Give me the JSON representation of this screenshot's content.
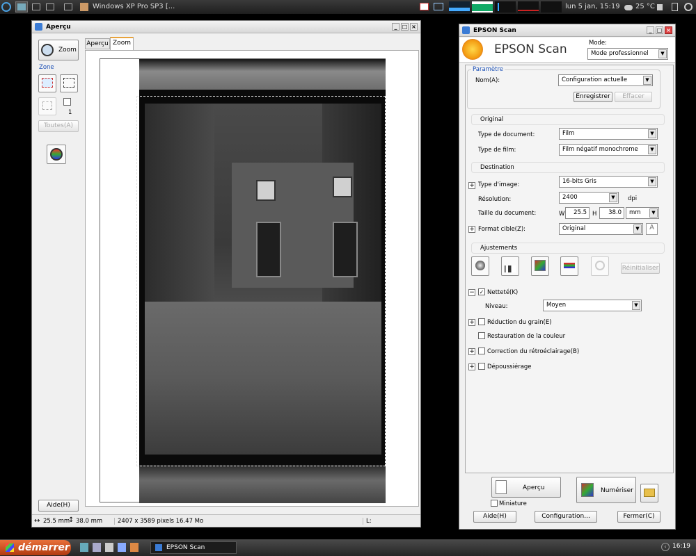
{
  "top_panel": {
    "task_title": "Windows XP Pro SP3 [...",
    "clock": "lun  5 jan, 15:19",
    "temperature": "25 °C"
  },
  "preview_window": {
    "title": "Aperçu",
    "zoom_button": "Zoom",
    "zone_label": "Zone",
    "count_label": "1",
    "all_button": "Toutes(A)",
    "tabs": [
      "Aperçu",
      "Zoom"
    ],
    "help_button": "Aide(H)",
    "status": {
      "width": "25.5 mm",
      "height": "38.0 mm",
      "pixels": "2407 x 3589 pixels 16.47 Mo",
      "l_label": "L:"
    }
  },
  "epson_window": {
    "title": "EPSON Scan",
    "brand": "EPSON Scan",
    "mode_label": "Mode:",
    "mode_value": "Mode professionnel",
    "parametre": {
      "legend": "Paramètre",
      "name_label": "Nom(A):",
      "name_value": "Configuration actuelle",
      "save_button": "Enregistrer",
      "delete_button": "Effacer"
    },
    "original": {
      "title": "Original",
      "doc_type_label": "Type de document:",
      "doc_type_value": "Film",
      "film_type_label": "Type de film:",
      "film_type_value": "Film négatif monochrome"
    },
    "destination": {
      "title": "Destination",
      "image_type_label": "Type d'image:",
      "image_type_value": "16-bits Gris",
      "resolution_label": "Résolution:",
      "resolution_value": "2400",
      "resolution_unit": "dpi",
      "doc_size_label": "Taille du document:",
      "w_label": "W",
      "w_value": "25.5",
      "h_label": "H",
      "h_value": "38.0",
      "unit_value": "mm",
      "target_label": "Format cible(Z):",
      "target_value": "Original"
    },
    "adjustments": {
      "title": "Ajustements",
      "reset_button": "Réinitialiser",
      "sharpness_label": "Netteté(K)",
      "sharpness_checked": true,
      "level_label": "Niveau:",
      "level_value": "Moyen",
      "grain_label": "Réduction du grain(E)",
      "color_restore_label": "Restauration de la couleur",
      "backlight_label": "Correction du rétroéclairage(B)",
      "dust_label": "Dépoussiérage"
    },
    "preview_button": "Aperçu",
    "scan_button": "Numériser",
    "thumbnail_label": "Miniature",
    "help_button": "Aide(H)",
    "config_button": "Configuration...",
    "close_button": "Fermer(C)"
  },
  "taskbar": {
    "start_label": "démarrer",
    "task_label": "EPSON Scan",
    "clock": "16:19"
  },
  "colors": {
    "titlebar_bg": "#dcdcdc",
    "window_bg": "#f0f0f0",
    "taskbar_bg": "#333333",
    "start_text": "#ffffff"
  }
}
